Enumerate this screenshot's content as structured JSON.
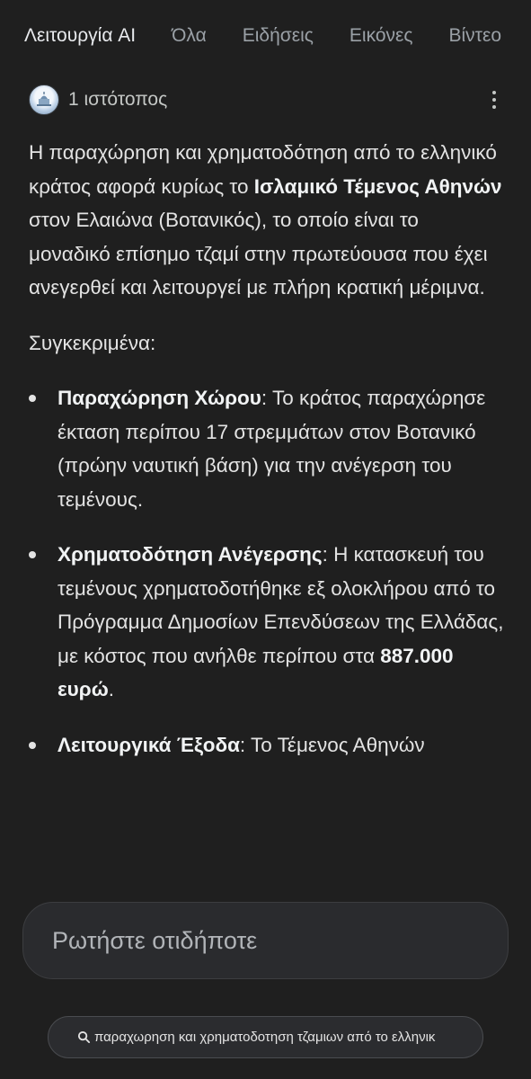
{
  "tabs": [
    "Λειτουργία AI",
    "Όλα",
    "Ειδήσεις",
    "Εικόνες",
    "Βίντεο"
  ],
  "source": {
    "count_label": "1 ιστότοπος",
    "favicon": "site-favicon-icon",
    "menu_icon": "more-vert-icon"
  },
  "answer": {
    "intro_pre": "Η παραχώρηση και χρηματοδότηση από το ελληνικό κράτος αφορά κυρίως το ",
    "intro_bold": "Ισλαμικό Τέμενος Αθηνών",
    "intro_post": " στον Ελαιώνα (Βοτανικός), το οποίο είναι το μοναδικό επίσημο τζαμί στην πρωτεύουσα που έχει ανεγερθεί και λειτουργεί με πλήρη κρατική μέριμνα.",
    "specifically": "Συγκεκριμένα:",
    "bullets": [
      {
        "title": "Παραχώρηση Χώρου",
        "text": ": Το κράτος παραχώρησε έκταση περίπου 17 στρεμμάτων στον Βοτανικό (πρώην ναυτική βάση) για την ανέγερση του τεμένους."
      },
      {
        "title": "Χρηματοδότηση Ανέγερσης",
        "text": ": Η κατασκευή του τεμένους χρηματοδοτήθηκε εξ ολοκλήρου από το Πρόγραμμα Δημοσίων Επενδύσεων της Ελλάδας, με κόστος που ανήλθε περίπου στα ",
        "amount": "887.000 ευρώ",
        "tail": "."
      },
      {
        "title": "Λειτουργικά Έξοδα",
        "text": ": Το Τέμενος Αθηνών"
      }
    ]
  },
  "ask": {
    "placeholder": "Ρωτήστε οτιδήποτε"
  },
  "query": {
    "text": "παραχωρηση και χρηματοδοτηση τζαμιων από το ελληνικ",
    "icon": "search-icon"
  },
  "colors": {
    "background": "#1f1f1f",
    "text": "#e3e3e3",
    "muted": "#9aa0a6"
  }
}
